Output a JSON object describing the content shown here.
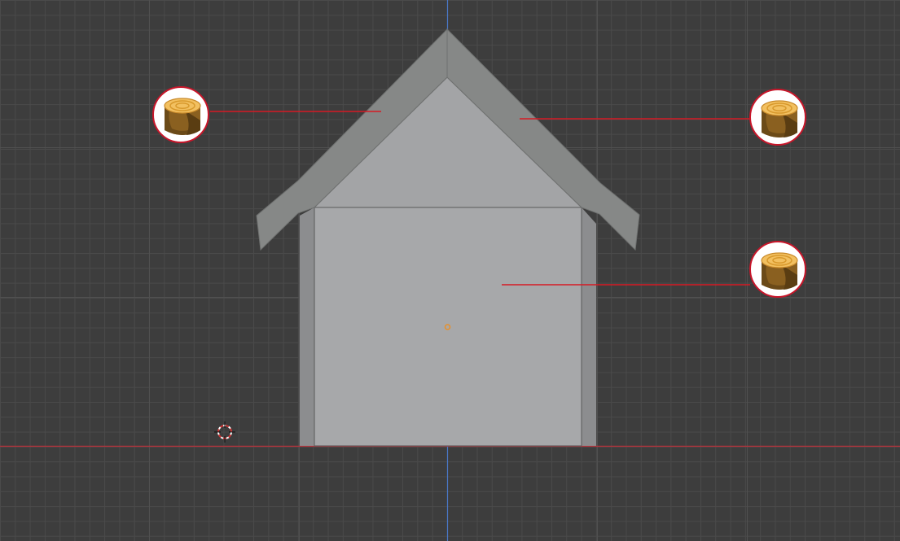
{
  "viewport": {
    "background": "#3d3d3d",
    "grid_color": "#4a4a4a",
    "x_axis_color": "#c0303a",
    "z_axis_color": "#4a78c8"
  },
  "house": {
    "wall_color": "#a7a8aa",
    "wall_side_color": "#8c8d8f",
    "gable_color": "#a3a4a6",
    "roof_color": "#868887",
    "roof_edge_color": "#6f7170",
    "origin_color": "#e8902a"
  },
  "callouts": [
    {
      "name": "roof-left-callout",
      "icon": "wood-log-icon",
      "line_color": "#d61a24"
    },
    {
      "name": "roof-right-callout",
      "icon": "wood-log-icon",
      "line_color": "#d61a24"
    },
    {
      "name": "wall-callout",
      "icon": "wood-log-icon",
      "line_color": "#d61a24"
    }
  ],
  "cursor": {
    "icon": "3d-cursor-icon",
    "color": "#cc3333"
  }
}
